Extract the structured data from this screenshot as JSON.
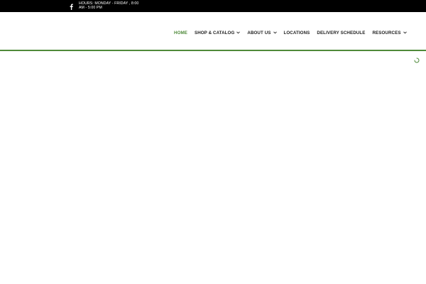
{
  "topbar": {
    "social_icon": "facebook-icon",
    "hours_text": "HOURS: MONDAY - FRIDAY , 8:00 AM - 5:00 PM"
  },
  "nav": {
    "items": [
      {
        "label": "HOME",
        "active": true,
        "dropdown": false
      },
      {
        "label": "SHOP & CATALOG",
        "active": false,
        "dropdown": true
      },
      {
        "label": "ABOUT US",
        "active": false,
        "dropdown": true
      },
      {
        "label": "LOCATIONS",
        "active": false,
        "dropdown": false
      },
      {
        "label": "DELIVERY SCHEDULE",
        "active": false,
        "dropdown": false
      },
      {
        "label": "RESOURCES",
        "active": false,
        "dropdown": true
      }
    ]
  },
  "colors": {
    "accent": "#4f8a3a",
    "topbar": "#000000",
    "nav_text": "#222222"
  },
  "loading_icon": "loading-spinner-icon"
}
